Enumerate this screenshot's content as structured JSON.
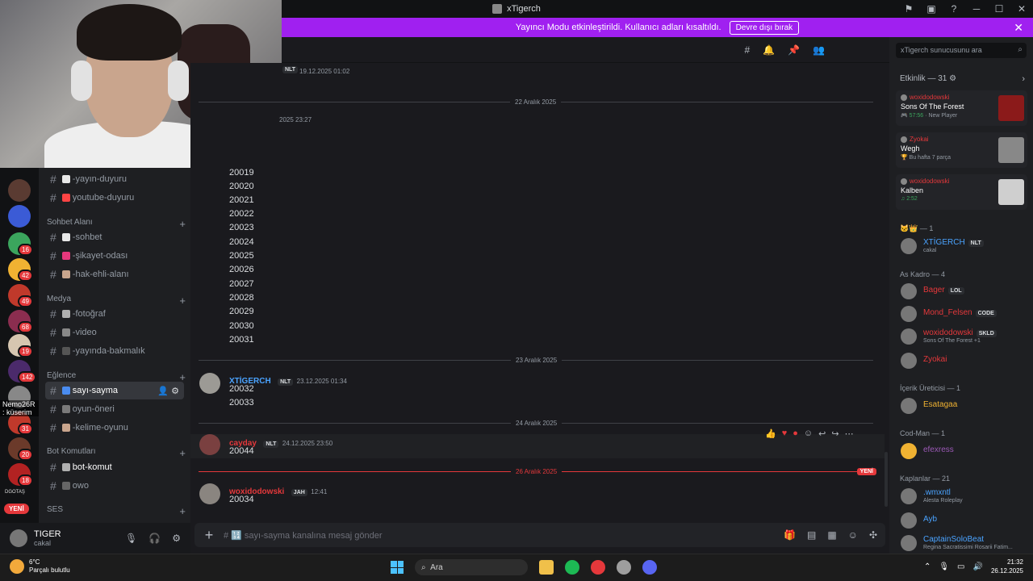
{
  "window": {
    "title": "xTigerch",
    "icons": [
      "flag-icon",
      "inbox-icon",
      "help-icon",
      "minimize-icon",
      "maximize-icon",
      "close-icon"
    ]
  },
  "banner": {
    "text": "Yayıncı Modu etkinleştirildi. Kullanıcı adları kısaltıldı.",
    "button": "Devre dışı bırak"
  },
  "server_list": {
    "yeni_label": "YENİ",
    "overlay_text": "Nemo26R : küserim",
    "badges": [
      "16",
      "42",
      "49",
      "68",
      "19",
      "142",
      "31",
      "20",
      "18"
    ],
    "dogtas_label": "DGOTAŞ"
  },
  "channels": {
    "items": [
      {
        "name": "-yayın-duyuru",
        "icon_color": "#e8e8e8"
      },
      {
        "name": "youtube-duyuru",
        "icon_color": "#ff4444"
      }
    ],
    "categories": [
      {
        "name": "Sohbet Alanı",
        "channels": [
          {
            "name": "-sohbet",
            "icon_color": "#e8e8e8"
          },
          {
            "name": "-şikayet-odası",
            "icon_color": "#e5387c"
          },
          {
            "name": "-hak-ehli-alanı",
            "icon_color": "#c9a58d"
          }
        ]
      },
      {
        "name": "Medya",
        "channels": [
          {
            "name": "-fotoğraf",
            "icon_color": "#b0b0b0"
          },
          {
            "name": "-video",
            "icon_color": "#888"
          },
          {
            "name": "-yayında-bakmalık",
            "icon_color": "#555"
          }
        ]
      },
      {
        "name": "Eğlence",
        "channels": [
          {
            "name": "sayı-sayma",
            "icon_color": "#4a8cf0",
            "active": true
          },
          {
            "name": "oyun-öneri",
            "icon_color": "#7a7a7a"
          },
          {
            "name": "-kelime-oyunu",
            "icon_color": "#c9a58d"
          }
        ]
      },
      {
        "name": "Bot Komutları",
        "channels": [
          {
            "name": "bot-komut",
            "icon_color": "#b0b0b0",
            "bold": true
          },
          {
            "name": "owo",
            "icon_color": "#666"
          }
        ]
      },
      {
        "name": "SES",
        "channels": []
      }
    ]
  },
  "user_panel": {
    "name": "TIGER",
    "status": "cakal",
    "icons": [
      "microphone-icon",
      "headphones-icon",
      "settings-icon"
    ]
  },
  "chat_header": {
    "icons": [
      "threads-icon",
      "bell-icon",
      "pin-icon",
      "members-icon"
    ],
    "search_placeholder": "xTigerch sunucusunu ara"
  },
  "messages": {
    "top_tag": "NLT",
    "top_timestamp": "19.12.2025 01:02",
    "date1": "22 Aralık 2025",
    "partial_timestamp": "2025 23:27",
    "numbers": [
      "20019",
      "20020",
      "20021",
      "20022",
      "20023",
      "20024",
      "20025",
      "20026",
      "20027",
      "20028",
      "20029",
      "20030",
      "20031"
    ],
    "date2": "23 Aralık 2025",
    "msg1": {
      "author": "XTİGERCH",
      "tag": "NLT",
      "timestamp": "23.12.2025 01:34",
      "lines": [
        "20032",
        "20033"
      ],
      "color": "#4aa3ff"
    },
    "date3": "24 Aralık 2025",
    "msg2": {
      "author": "cayday",
      "tag": "NLT",
      "timestamp": "24.12.2025 23:50",
      "lines": [
        "20044"
      ],
      "color": "#e5383b"
    },
    "date4": "26 Aralık 2025",
    "new_label": "YENİ",
    "msg3": {
      "author": "woxidodowski",
      "tag": "JAH",
      "timestamp": "12:41",
      "lines": [
        "20034"
      ],
      "color": "#e5383b"
    }
  },
  "composer": {
    "placeholder": "# 🔢 sayı-sayma kanalına mesaj gönder"
  },
  "activity": {
    "header": "Etkinlik — 31",
    "cards": [
      {
        "user": "woxidodowski",
        "title": "Sons Of The Forest",
        "sub1": "57:56",
        "sub2": "New Player",
        "thumb": "#8b1a1a"
      },
      {
        "user": "Zyokai",
        "title": "Wegh",
        "sub1": "Bu hafta 7 parça",
        "sub2": "",
        "thumb": "#888888"
      },
      {
        "user": "woxidodowski",
        "title": "Kalben",
        "sub1": "2:52",
        "sub2": "",
        "thumb": "#cfcfcf"
      }
    ]
  },
  "members": {
    "groups": [
      {
        "label": "— 1",
        "members": [
          {
            "name": "XTİGERCH",
            "tag": "NLT",
            "status": "cakal",
            "color": "#4aa3ff"
          }
        ]
      },
      {
        "label": "As Kadro — 4",
        "members": [
          {
            "name": "Bager",
            "tag": "LOL",
            "status": "",
            "color": "#e5383b"
          },
          {
            "name": "Mond_Felsen",
            "tag": "CODE",
            "status": "",
            "color": "#e5383b"
          },
          {
            "name": "woxidodowski",
            "tag": "SKLD",
            "status": "Sons Of The Forest +1",
            "color": "#e5383b"
          },
          {
            "name": "Zyokai",
            "tag": "",
            "status": "",
            "color": "#e5383b"
          }
        ]
      },
      {
        "label": "İçerik Üreticisi — 1",
        "members": [
          {
            "name": "Esatagaa",
            "tag": "",
            "status": "",
            "color": "#f0b232"
          }
        ]
      },
      {
        "label": "Cod-Man — 1",
        "members": [
          {
            "name": "efexress",
            "tag": "",
            "status": "",
            "color": "#9b59b6"
          }
        ]
      },
      {
        "label": "Kaplanlar — 21",
        "members": [
          {
            "name": ".wmxntl",
            "tag": "",
            "status": "Alesta Roleplay",
            "color": "#4aa3ff"
          },
          {
            "name": "Ayb",
            "tag": "",
            "status": "",
            "color": "#4aa3ff"
          },
          {
            "name": "CaptainSoloBeat",
            "tag": "",
            "status": "Regina Sacratissimi Rosarii Fatim...",
            "color": "#4aa3ff"
          }
        ]
      }
    ]
  },
  "taskbar": {
    "weather_temp": "6°C",
    "weather_desc": "Parçalı bulutlu",
    "search": "Ara",
    "time": "21:32",
    "date": "26.12.2025"
  }
}
